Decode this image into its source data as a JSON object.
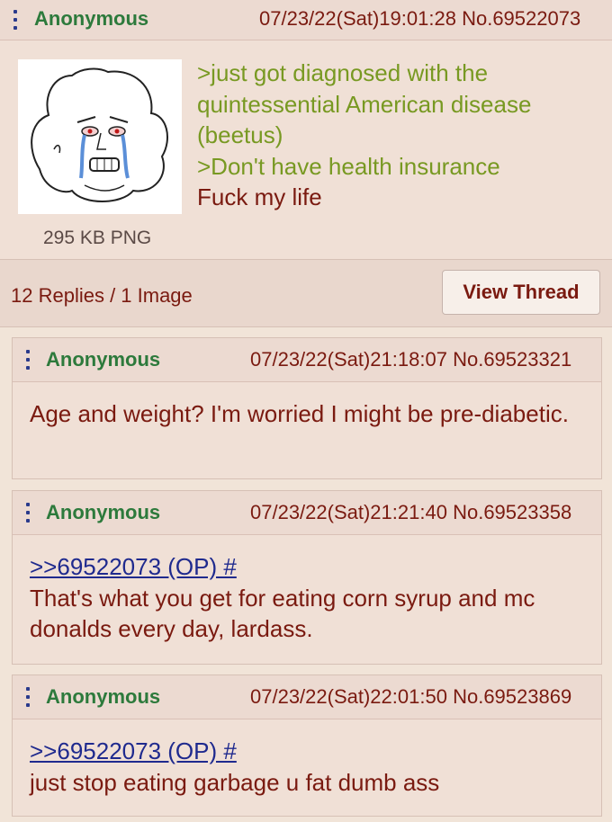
{
  "op": {
    "name": "Anonymous",
    "datetime": "07/23/22(Sat)19:01:28",
    "post_no": "No.69522073",
    "file_info": "295 KB PNG",
    "lines": [
      ">just got diagnosed with the quintessential American disease (beetus)",
      ">Don't have health insurance",
      "Fuck my life"
    ],
    "replies_summary": "12 Replies / 1 Image",
    "view_thread_label": "View Thread"
  },
  "replies": [
    {
      "name": "Anonymous",
      "datetime": "07/23/22(Sat)21:18:07",
      "post_no": "No.69523321",
      "text": "Age and weight? I'm worried I might be pre-diabetic."
    },
    {
      "name": "Anonymous",
      "datetime": "07/23/22(Sat)21:21:40",
      "post_no": "No.69523358",
      "quote": ">>69522073 (OP) #",
      "text": "That's what you get for eating corn syrup and mc donalds every day, lardass."
    },
    {
      "name": "Anonymous",
      "datetime": "07/23/22(Sat)22:01:50",
      "post_no": "No.69523869",
      "quote": ">>69522073 (OP) #",
      "text": "just stop eating garbage u fat dumb ass"
    }
  ],
  "colors": {
    "name_green": "#2d7a3c",
    "greentext": "#789922",
    "body_text": "#7a1a10",
    "quotelink": "#1f2a8e",
    "post_bg": "#f0e0d6"
  }
}
